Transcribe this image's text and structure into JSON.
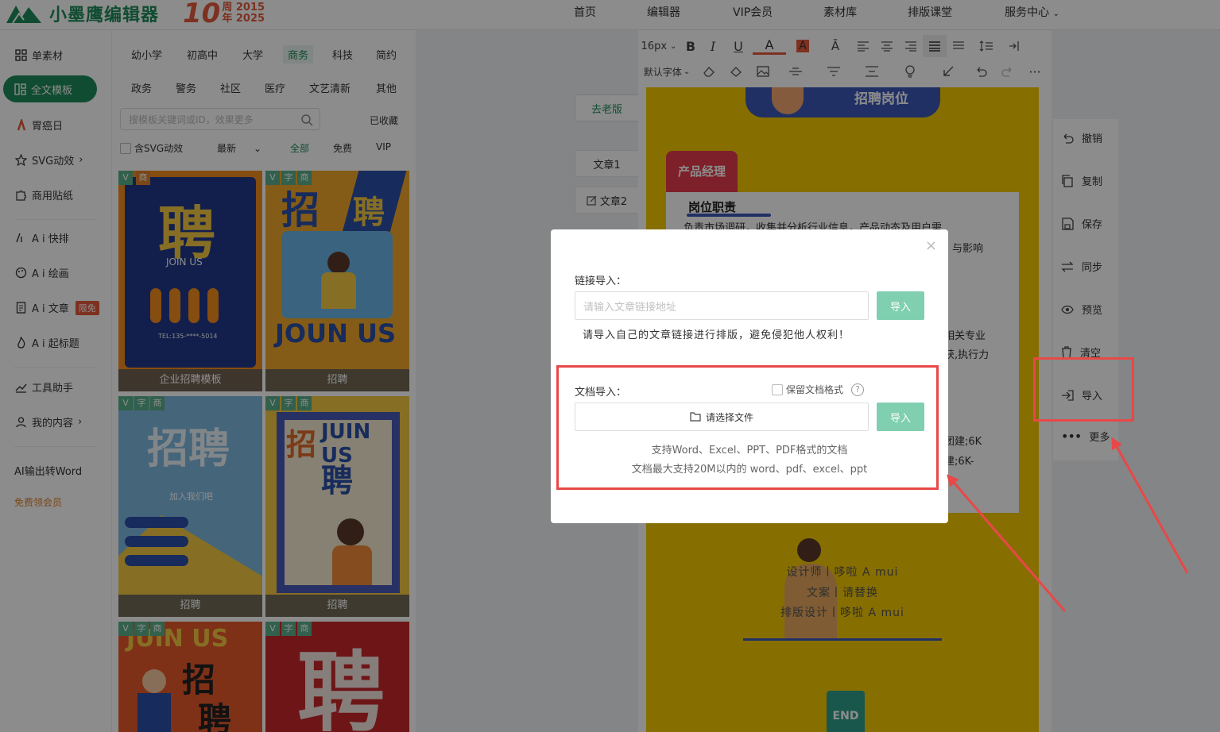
{
  "brand": {
    "name": "小墨鹰编辑器",
    "anniv_num": "10",
    "anniv_line1": "周 2015",
    "anniv_line2": "年 2025"
  },
  "topnav": [
    "首页",
    "编辑器",
    "VIP会员",
    "素材库",
    "排版课堂",
    "服务中心"
  ],
  "sidebar": {
    "items": [
      {
        "label": "单素材"
      },
      {
        "label": "全文模板"
      },
      {
        "label": "胃癌日"
      },
      {
        "label": "SVG动效"
      },
      {
        "label": "商用贴纸"
      },
      {
        "label": "A i 快排"
      },
      {
        "label": "A i 绘画"
      },
      {
        "label": "A i 文章"
      },
      {
        "label": "A i 起标题"
      },
      {
        "label": "工具助手"
      },
      {
        "label": "我的内容"
      }
    ],
    "free_badge": "限免",
    "ai_word": "AI输出转Word",
    "free_member": "免费领会员"
  },
  "templates": {
    "categories_row1": [
      "幼小学",
      "初高中",
      "大学",
      "商务",
      "科技",
      "简约"
    ],
    "categories_row2": [
      "政务",
      "警务",
      "社区",
      "医疗",
      "文艺清新",
      "其他"
    ],
    "search_placeholder": "搜模板关键词或ID，效果更多",
    "favorites": "已收藏",
    "filters": {
      "svg": "含SVG动效",
      "sort": "最新",
      "all": "全部",
      "free": "免费",
      "vip": "VIP"
    },
    "cards": [
      {
        "caption": "企业招聘模板",
        "tag1": "V",
        "tag2": "商"
      },
      {
        "caption": "招聘",
        "tag1": "V",
        "tag2": "字",
        "tag3": "商"
      },
      {
        "caption": "招聘",
        "tag1": "V",
        "tag2": "字",
        "tag3": "商"
      },
      {
        "caption": "招聘",
        "tag1": "V",
        "tag2": "字",
        "tag3": "商"
      },
      {
        "caption": "",
        "tag1": "V",
        "tag2": "字",
        "tag3": "商"
      },
      {
        "caption": "",
        "tag1": "V",
        "tag2": "字",
        "tag3": "商"
      }
    ],
    "card_text": {
      "c1_big": "聘",
      "c1_join": "JOIN US",
      "c1_tel": "TEL:135-****-5014",
      "c2_a": "招",
      "c2_b": "聘",
      "c2_join": "JOUN US",
      "c3_big": "招聘",
      "c3_sub": "加入我们吧",
      "c4_a": "招",
      "c4_b": "聘",
      "c4_join": "JUIN US",
      "c5_a": "JUIN US",
      "c5_b": "招",
      "c5_c": "聘",
      "c6_big": "聘"
    }
  },
  "articles": {
    "old_version": "去老版",
    "items": [
      "文章1",
      "文章2"
    ]
  },
  "toolbar": {
    "font_size": "16px",
    "font_family": "默认字体"
  },
  "canvas": {
    "recruit_title": "招聘岗位",
    "position": "产品经理",
    "duties_title": "岗位职责",
    "lines": [
      "负责市场调研，收集并分析行业信息，产品动态及用户需",
      "与影响",
      "相关专业",
      "获,执行力",
      "团建;6K",
      "建;6K-"
    ],
    "credits": [
      "设计师丨哆啦 A mui",
      "文案丨请替换",
      "排版设计丨哆啦 A mui"
    ],
    "end": "END"
  },
  "right_tools": [
    "撤销",
    "复制",
    "保存",
    "同步",
    "预览",
    "清空",
    "导入",
    "更多"
  ],
  "modal": {
    "link_label": "链接导入：",
    "link_placeholder": "请输入文章链接地址",
    "import_btn": "导入",
    "link_note": "请导入自己的文章链接进行排版，避免侵犯他人权利！",
    "doc_label": "文档导入：",
    "keep_format": "保留文档格式",
    "choose_file": "请选择文件",
    "hint1": "支持Word、Excel、PPT、PDF格式的文档",
    "hint2": "文档最大支持20M以内的 word、pdf、excel、ppt"
  },
  "colors": {
    "brand_green": "#1e8a5a",
    "canvas_yellow": "#f5c800",
    "annot_red": "#e84848",
    "import_btn": "#7fcfb0"
  }
}
